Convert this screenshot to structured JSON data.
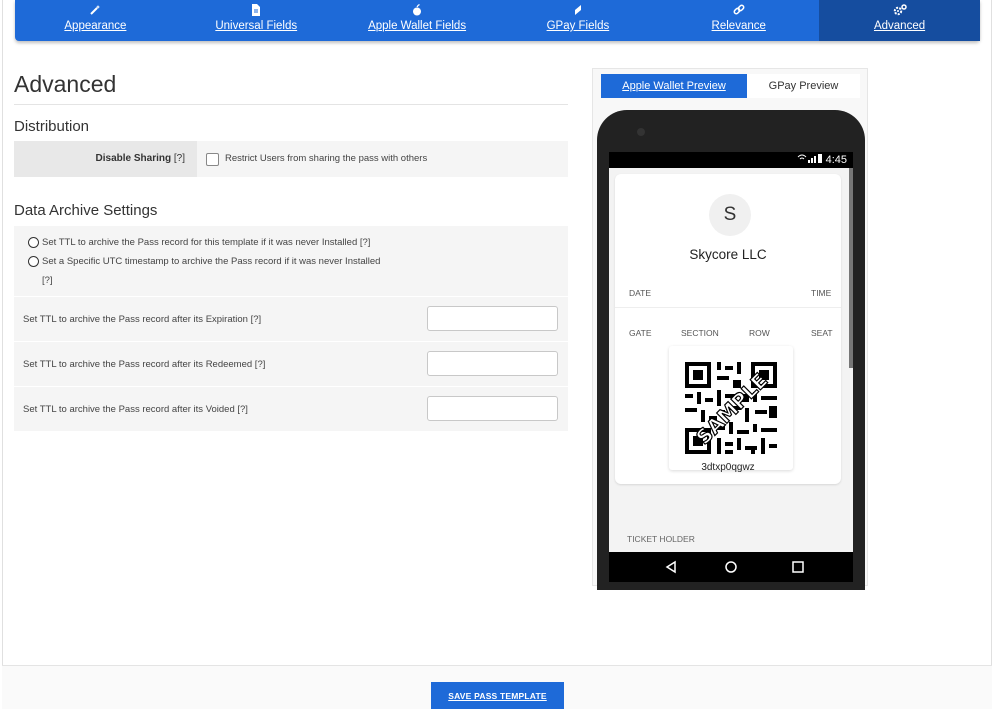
{
  "tabs": [
    {
      "label": "Appearance",
      "icon": "wand-icon"
    },
    {
      "label": "Universal Fields",
      "icon": "file-icon"
    },
    {
      "label": "Apple Wallet Fields",
      "icon": "apple-icon"
    },
    {
      "label": "GPay Fields",
      "icon": "gpay-icon"
    },
    {
      "label": "Relevance",
      "icon": "link-icon"
    },
    {
      "label": "Advanced",
      "icon": "gears-icon"
    }
  ],
  "page": {
    "title": "Advanced",
    "distribution": {
      "heading": "Distribution",
      "label": "Disable Sharing",
      "help": "[?]",
      "checkbox_label": "Restrict Users from sharing the pass with others",
      "checked": false
    },
    "archive": {
      "heading": "Data Archive Settings",
      "radio1": "Set TTL to archive the Pass record for this template if it was never Installed [?]",
      "radio2_line1": "Set a Specific UTC timestamp to archive the Pass record if it was never Installed",
      "radio2_line2": "[?]",
      "row1": "Set TTL to archive the Pass record after its Expiration [?]",
      "row2": "Set TTL to archive the Pass record after its Redeemed [?]",
      "row3": "Set TTL to archive the Pass record after its Voided [?]",
      "row1_value": "",
      "row2_value": "",
      "row3_value": ""
    }
  },
  "preview": {
    "tab_apple": "Apple Wallet Preview",
    "tab_gpay": "GPay Preview",
    "status_time": "4:45",
    "avatar_letter": "S",
    "org_name": "Skycore LLC",
    "labels": {
      "date": "DATE",
      "time": "TIME",
      "gate": "GATE",
      "section": "SECTION",
      "row": "ROW",
      "seat": "SEAT"
    },
    "qr_watermark": "SAMPLE",
    "code": "3dtxp0qgwz",
    "ticket_holder": "TICKET HOLDER"
  },
  "save_label": "SAVE PASS TEMPLATE",
  "colors": {
    "accent": "#1e6ad8",
    "accent_dark": "#154d9f"
  }
}
